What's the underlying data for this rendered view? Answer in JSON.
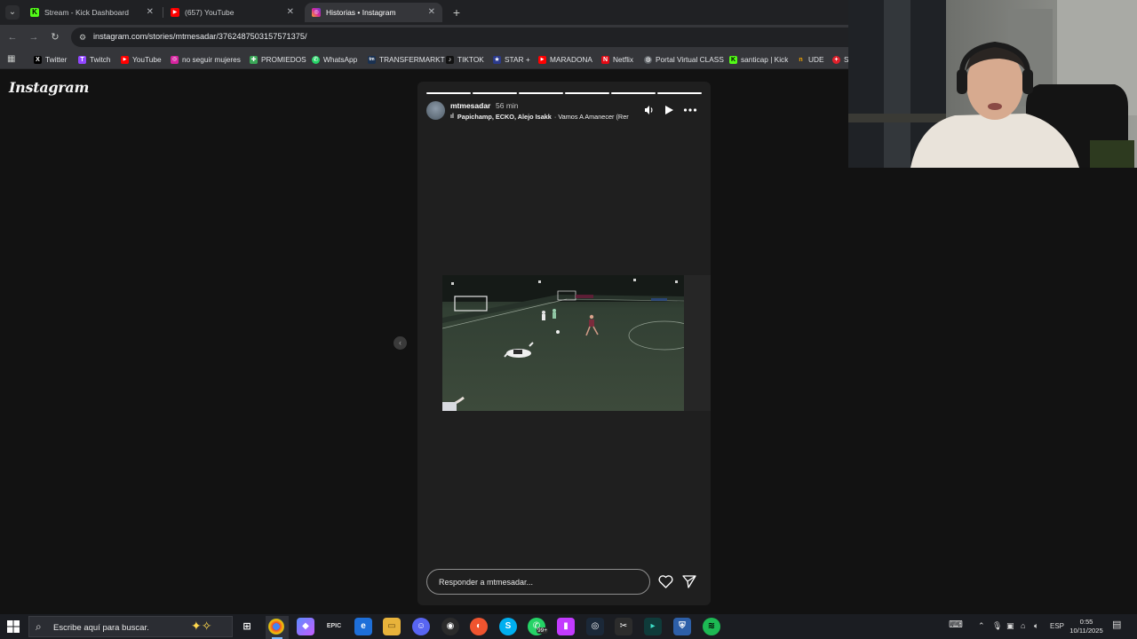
{
  "browser": {
    "tabs": [
      {
        "label": "Stream - Kick Dashboard",
        "icon": "kick-icon",
        "active": false
      },
      {
        "label": "(657) YouTube",
        "icon": "youtube-icon",
        "active": false
      },
      {
        "label": "Historias • Instagram",
        "icon": "instagram-icon",
        "active": true
      }
    ],
    "url": "instagram.com/stories/mtmesadar/3762487503157571375/",
    "bookmarks": [
      {
        "label": "Twitter",
        "icon": "x-icon",
        "color": "#000000"
      },
      {
        "label": "Twitch",
        "icon": "twitch-icon",
        "color": "#9146ff"
      },
      {
        "label": "YouTube",
        "icon": "youtube-icon",
        "color": "#ff0000"
      },
      {
        "label": "no seguir mujeres",
        "icon": "instagram-icon",
        "color": "#d6249f"
      },
      {
        "label": "PROMIEDOS",
        "icon": "promiedos-icon",
        "color": "#3aa757"
      },
      {
        "label": "WhatsApp",
        "icon": "whatsapp-icon",
        "color": "#25d366"
      },
      {
        "label": "TRANSFERMARKT",
        "icon": "transfermarkt-icon",
        "color": "#1a3151"
      },
      {
        "label": "TIKTOK",
        "icon": "tiktok-icon",
        "color": "#111111"
      },
      {
        "label": "STAR +",
        "icon": "star-icon",
        "color": "#2b3a8c"
      },
      {
        "label": "MARADONA",
        "icon": "youtube-icon",
        "color": "#ff0000"
      },
      {
        "label": "Netflix",
        "icon": "netflix-icon",
        "color": "#e50914"
      },
      {
        "label": "Portal Virtual CLASS",
        "icon": "globe-icon",
        "color": "#5f6368"
      },
      {
        "label": "santicap | Kick",
        "icon": "kick-icon",
        "color": "#53fc18"
      },
      {
        "label": "UDE",
        "icon": "ude-icon",
        "color": "#f2a300"
      },
      {
        "label": "S",
        "icon": "opera-icon",
        "color": "#e0202b"
      }
    ]
  },
  "instagram": {
    "logo": "Instagram",
    "story": {
      "username": "mtmesadar",
      "time": "56 min",
      "music_artists": "Papichamp, ECKO, Alejo Isakk",
      "music_title": "· Vamos A Amanecer (Rer",
      "segments": 6,
      "reply_placeholder": "Responder a mtmesadar..."
    }
  },
  "taskbar": {
    "search_placeholder": "Escribe aquí para buscar.",
    "language": "ESP",
    "time": "0:55",
    "date": "10/11/2025",
    "whatsapp_badge": "99+"
  }
}
